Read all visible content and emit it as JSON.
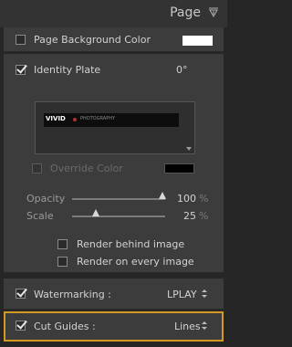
{
  "header": {
    "title": "Page"
  },
  "page_background": {
    "label": "Page Background Color",
    "checked": false,
    "color": "#ffffff"
  },
  "identity_plate": {
    "label": "Identity Plate",
    "checked": true,
    "angle": "0°",
    "plate_logo": "VIVID",
    "plate_subtitle": "PHOTOGRAPHY",
    "override_label": "Override Color",
    "override_color": "#000000",
    "opacity_label": "Opacity",
    "opacity_value": "100",
    "opacity_unit": "%",
    "opacity_level": 1.0,
    "scale_label": "Scale",
    "scale_value": "25",
    "scale_unit": "%",
    "scale_level": 0.25,
    "render_behind_label": "Render behind image",
    "render_every_label": "Render on every image"
  },
  "watermarking": {
    "label": "Watermarking :",
    "value": "LPLAY",
    "checked": true
  },
  "cut_guides": {
    "label": "Cut Guides :",
    "value": "Lines",
    "checked": true
  },
  "colors": {
    "highlight": "#d39a22",
    "panel": "#3c3c3c"
  }
}
